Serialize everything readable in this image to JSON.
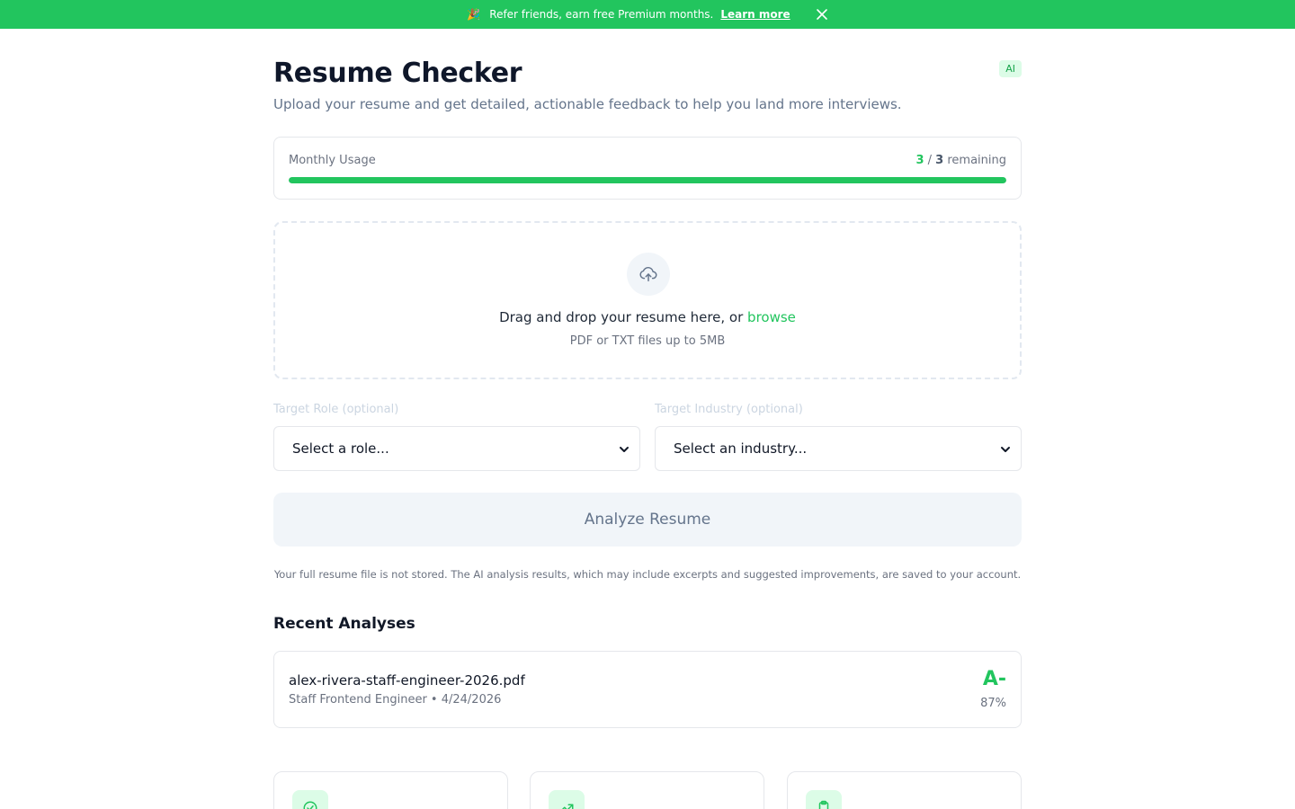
{
  "banner": {
    "emoji": "🎉",
    "text": "Refer friends, earn free Premium months.",
    "link": "Learn more"
  },
  "header": {
    "title": "Resume Checker",
    "badge": "AI",
    "subtitle": "Upload your resume and get detailed, actionable feedback to help you land more interviews."
  },
  "usage": {
    "label": "Monthly Usage",
    "used": "3",
    "separator": "/",
    "total": "3",
    "suffix": "remaining",
    "progress_fraction": 1.0
  },
  "dropzone": {
    "text": "Drag and drop your resume here, or",
    "browse": "browse",
    "hint": "PDF or TXT files up to 5MB"
  },
  "form": {
    "role_label": "Target Role (optional)",
    "role_value": "Select a role...",
    "industry_label": "Target Industry (optional)",
    "industry_value": "Select an industry..."
  },
  "analyze_button": "Analyze Resume",
  "privacy_note": "Your full resume file is not stored. The AI analysis results, which may include excerpts and suggested improvements, are saved to your account.",
  "recent": {
    "heading": "Recent Analyses",
    "items": [
      {
        "file": "alex-rivera-staff-engineer-2026.pdf",
        "meta": "Staff Frontend Engineer • 4/24/2026",
        "grade": "A-",
        "score": "87%"
      }
    ]
  },
  "features": [
    {
      "icon": "check-circle-icon"
    },
    {
      "icon": "trending-up-icon"
    },
    {
      "icon": "clipboard-icon"
    }
  ],
  "colors": {
    "accent": "#22c55e",
    "accent_light": "#dcfce7",
    "muted": "#6b7280"
  }
}
